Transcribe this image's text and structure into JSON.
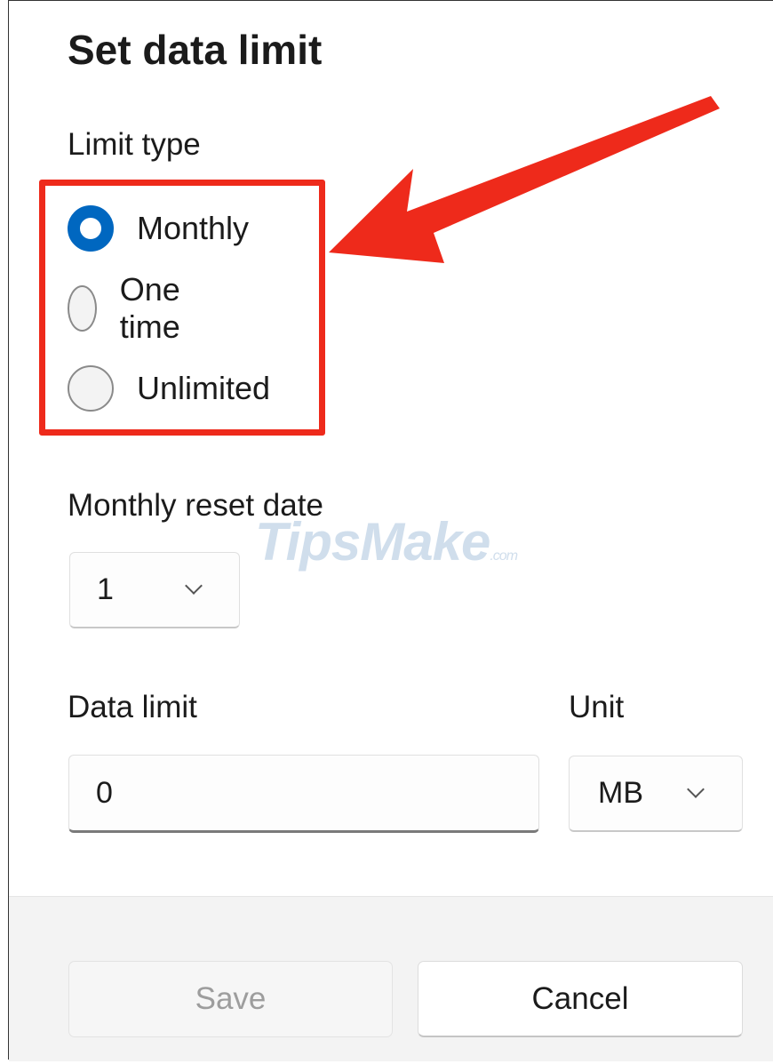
{
  "dialog": {
    "title": "Set data limit",
    "limit_type_label": "Limit type",
    "limit_options": [
      {
        "label": "Monthly",
        "checked": true
      },
      {
        "label": "One time",
        "checked": false
      },
      {
        "label": "Unlimited",
        "checked": false
      }
    ],
    "reset_date_label": "Monthly reset date",
    "reset_date_value": "1",
    "data_limit_label": "Data limit",
    "data_limit_value": "0",
    "unit_label": "Unit",
    "unit_value": "MB",
    "save_label": "Save",
    "cancel_label": "Cancel"
  },
  "watermark": {
    "text": "TipsMake",
    "suffix": ".com"
  },
  "colors": {
    "accent": "#0067c0",
    "annotation": "#ee2a1b"
  }
}
